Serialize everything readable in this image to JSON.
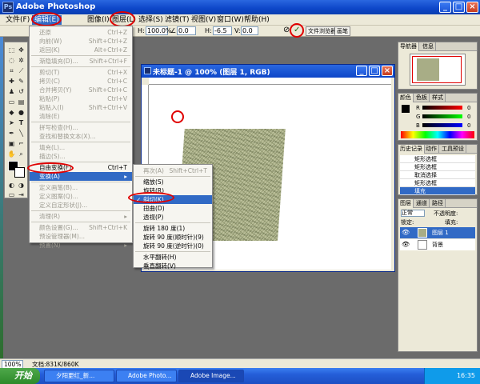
{
  "window": {
    "title": "Adobe Photoshop",
    "min": "_",
    "max": "□",
    "close": "×"
  },
  "menubar": [
    {
      "label": "文件(F)"
    },
    {
      "label": "编辑(E)"
    },
    {
      "label": "图像(I)"
    },
    {
      "label": "图层(L)"
    },
    {
      "label": "选择(S)"
    },
    {
      "label": "滤镜(T)"
    },
    {
      "label": "视图(V)"
    },
    {
      "label": "窗口(W)"
    },
    {
      "label": "帮助(H)"
    }
  ],
  "options": {
    "h_label": "H:",
    "h_value": "100.0%",
    "angle_value": "0.0",
    "h2_label": "H:",
    "h2_value": "-6.5",
    "v_label": "V:",
    "v_value": "0.0",
    "cancel_glyph": "⊘",
    "commit_glyph": "✓",
    "tab1": "文件浏览器",
    "tab2": "画笔"
  },
  "edit_menu": {
    "items": [
      {
        "label": "还原",
        "shortcut": "Ctrl+Z",
        "disabled": true
      },
      {
        "label": "向前(W)",
        "shortcut": "Shift+Ctrl+Z",
        "disabled": true
      },
      {
        "label": "返回(K)",
        "shortcut": "Alt+Ctrl+Z",
        "disabled": true
      },
      {
        "label": "渐隐填充(D)...",
        "shortcut": "Shift+Ctrl+F",
        "disabled": true
      },
      {
        "label": "剪切(T)",
        "shortcut": "Ctrl+X",
        "disabled": true
      },
      {
        "label": "拷贝(C)",
        "shortcut": "Ctrl+C",
        "disabled": true
      },
      {
        "label": "合并拷贝(Y)",
        "shortcut": "Shift+Ctrl+C",
        "disabled": true
      },
      {
        "label": "粘贴(P)",
        "shortcut": "Ctrl+V",
        "disabled": true
      },
      {
        "label": "粘贴入(I)",
        "shortcut": "Shift+Ctrl+V",
        "disabled": true
      },
      {
        "label": "清除(E)",
        "shortcut": "",
        "disabled": true
      },
      {
        "label": "拼写检查(H)...",
        "shortcut": "",
        "disabled": true
      },
      {
        "label": "查找和替换文本(X)...",
        "shortcut": "",
        "disabled": true
      },
      {
        "label": "填充(L)...",
        "shortcut": "",
        "disabled": true
      },
      {
        "label": "描边(S)...",
        "shortcut": "",
        "disabled": true
      },
      {
        "label": "自由变换(F)",
        "shortcut": "Ctrl+T",
        "disabled": false
      },
      {
        "label": "变换(A)",
        "shortcut": "▸",
        "disabled": false,
        "highlight": true
      },
      {
        "label": "定义画笔(B)...",
        "shortcut": "",
        "disabled": true
      },
      {
        "label": "定义图案(Q)...",
        "shortcut": "",
        "disabled": true
      },
      {
        "label": "定义自定形状(J)...",
        "shortcut": "",
        "disabled": true
      },
      {
        "label": "清理(R)",
        "shortcut": "▸",
        "disabled": true
      },
      {
        "label": "颜色设置(G)...",
        "shortcut": "Shift+Ctrl+K",
        "disabled": true
      },
      {
        "label": "预设管理器(M)...",
        "shortcut": "",
        "disabled": true
      },
      {
        "label": "预置(N)",
        "shortcut": "▸",
        "disabled": true
      }
    ]
  },
  "transform_menu": {
    "items": [
      {
        "label": "再次(A)",
        "shortcut": "Shift+Ctrl+T",
        "disabled": true
      },
      {
        "label": "缩放(S)",
        "shortcut": ""
      },
      {
        "label": "旋转(R)",
        "shortcut": ""
      },
      {
        "label": "斜切(K)",
        "shortcut": "",
        "highlight": true,
        "checked": true
      },
      {
        "label": "扭曲(D)",
        "shortcut": ""
      },
      {
        "label": "透视(P)",
        "shortcut": ""
      },
      {
        "label": "旋转 180 度(1)",
        "shortcut": ""
      },
      {
        "label": "旋转 90 度(顺时针)(9)",
        "shortcut": ""
      },
      {
        "label": "旋转 90 度(逆时针)(0)",
        "shortcut": ""
      },
      {
        "label": "水平翻转(H)",
        "shortcut": ""
      },
      {
        "label": "垂直翻转(V)",
        "shortcut": ""
      }
    ],
    "check_glyph": "✓"
  },
  "document": {
    "title": "未标题-1 @ 100% (图层 1, RGB)"
  },
  "panels": {
    "navigator": {
      "tab1": "导航器",
      "tab2": "信息"
    },
    "color": {
      "tab1": "颜色",
      "tab2": "色板",
      "tab3": "样式",
      "r_label": "R",
      "g_label": "G",
      "b_label": "B",
      "r_value": "0",
      "g_value": "0",
      "b_value": "0"
    },
    "history": {
      "tab1": "历史记录",
      "tab2": "动作",
      "tab3": "工具预设",
      "items": [
        {
          "label": "矩形选框"
        },
        {
          "label": "矩形选框"
        },
        {
          "label": "取消选择"
        },
        {
          "label": "矩形选框"
        },
        {
          "label": "填充",
          "selected": true
        }
      ]
    },
    "layers": {
      "tab1": "图层",
      "tab2": "通道",
      "tab3": "路径",
      "mode": "正常",
      "opacity_label": "不透明度:",
      "lock_label": "锁定:",
      "fill_label": "填充:",
      "items": [
        {
          "label": "图层 1",
          "selected": true
        },
        {
          "label": "背景"
        }
      ]
    }
  },
  "status": {
    "zoom": "100%",
    "doc": "文档:831K/860K"
  },
  "taskbar": {
    "start": "开始",
    "tasks": [
      {
        "label": "夕阳更红_新..."
      },
      {
        "label": "Adobe Photo..."
      },
      {
        "label": "Adobe Image..."
      }
    ],
    "clock": "16:35"
  },
  "colors": {
    "accent": "#316ac5",
    "highlight_ring": "#e00000",
    "xp_blue": "#0d46c8"
  }
}
